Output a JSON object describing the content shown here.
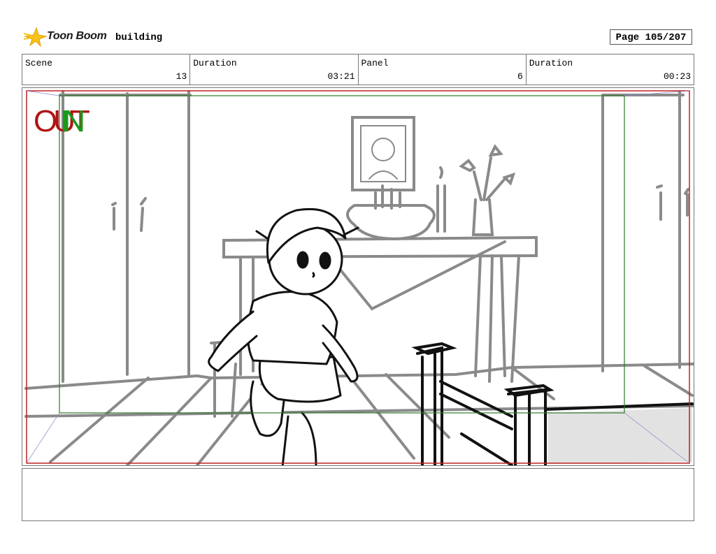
{
  "header": {
    "logo_text": "Toon Boom",
    "project_name": "building",
    "page_label": "Page 105/207"
  },
  "info": {
    "scene_label": "Scene",
    "scene_value": "13",
    "scene_duration_label": "Duration",
    "scene_duration_value": "03:21",
    "panel_label": "Panel",
    "panel_value": "6",
    "panel_duration_label": "Duration",
    "panel_duration_value": "00:23"
  },
  "panel": {
    "out_marker": "OUT",
    "in_marker": "IN",
    "colors": {
      "out": "#b01414",
      "in": "#1a9a1a",
      "frame_red": "#c02020",
      "frame_green": "#2a7a2a",
      "sketch_gray": "#8a8a8a"
    }
  },
  "notes": {
    "text": ""
  }
}
